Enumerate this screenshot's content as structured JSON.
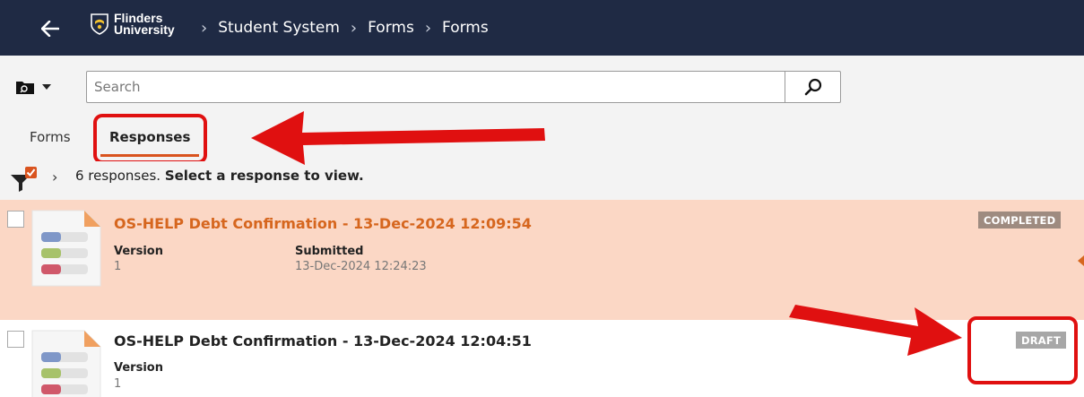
{
  "header": {
    "logo_line1": "Flinders",
    "logo_line2": "University",
    "breadcrumbs": [
      "Student System",
      "Forms",
      "Forms"
    ]
  },
  "search": {
    "value": "",
    "placeholder": "Search"
  },
  "tabs": [
    {
      "label": "Forms",
      "active": false
    },
    {
      "label": "Responses",
      "active": true
    }
  ],
  "summary": {
    "count_text": "6 responses.",
    "instruction": "Select a response to view."
  },
  "responses": [
    {
      "title": "OS-HELP Debt Confirmation - 13-Dec-2024 12:09:54",
      "version_label": "Version",
      "version": "1",
      "submitted_label": "Submitted",
      "submitted": "13-Dec-2024 12:24:23",
      "status": "COMPLETED",
      "selected": true
    },
    {
      "title": "OS-HELP Debt Confirmation - 13-Dec-2024 12:04:51",
      "version_label": "Version",
      "version": "1",
      "status": "DRAFT",
      "selected": false
    }
  ],
  "colors": {
    "header_bg": "#1f2a44",
    "accent": "#d9531e",
    "selected_row": "#fbd7c5",
    "annotation_red": "#e01010"
  }
}
